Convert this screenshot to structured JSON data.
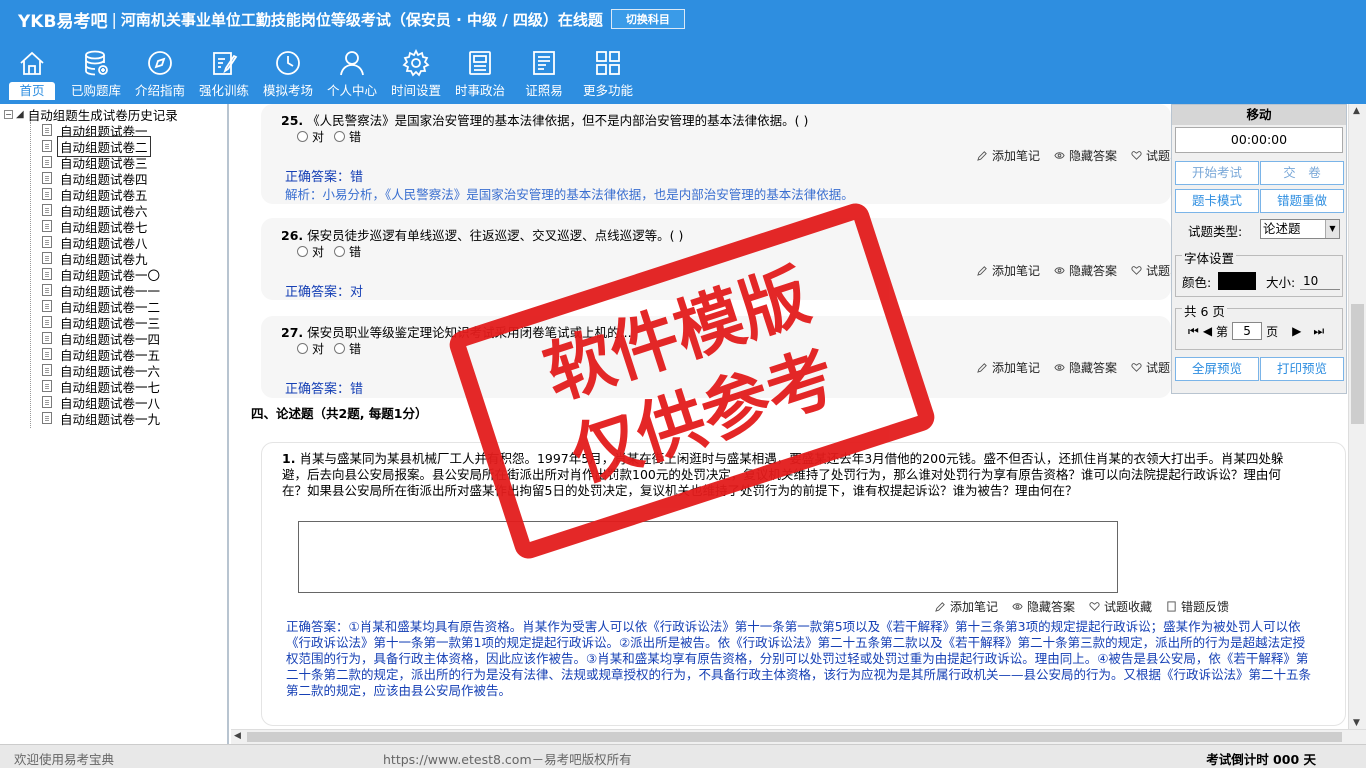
{
  "header": {
    "logo": "YKB易考吧",
    "separator": "|",
    "title": "河南机关事业单位工勤技能岗位等级考试（保安员 · 中级 / 四级）在线题",
    "switch_label": "切换科目"
  },
  "nav": [
    {
      "label": "首页",
      "icon": "home-icon"
    },
    {
      "label": "已购题库",
      "icon": "database-icon"
    },
    {
      "label": "介绍指南",
      "icon": "compass-icon"
    },
    {
      "label": "强化训练",
      "icon": "edit-icon"
    },
    {
      "label": "模拟考场",
      "icon": "clock-icon"
    },
    {
      "label": "个人中心",
      "icon": "user-icon"
    },
    {
      "label": "时间设置",
      "icon": "gear-icon"
    },
    {
      "label": "时事政治",
      "icon": "news-icon"
    },
    {
      "label": "证照易",
      "icon": "certificate-icon"
    },
    {
      "label": "更多功能",
      "icon": "grid-icon"
    }
  ],
  "tree": {
    "expander": "−",
    "root": "自动组题生成试卷历史记录",
    "items": [
      "自动组题试卷一",
      "自动组题试卷二",
      "自动组题试卷三",
      "自动组题试卷四",
      "自动组题试卷五",
      "自动组题试卷六",
      "自动组题试卷七",
      "自动组题试卷八",
      "自动组题试卷九",
      "自动组题试卷一〇",
      "自动组题试卷一一",
      "自动组题试卷一二",
      "自动组题试卷一三",
      "自动组题试卷一四",
      "自动组题试卷一五",
      "自动组题试卷一六",
      "自动组题试卷一七",
      "自动组题试卷一八",
      "自动组题试卷一九"
    ],
    "selected_index": 1
  },
  "questions": [
    {
      "num": "25.",
      "text": "《人民警察法》是国家治安管理的基本法律依据，但不是内部治安管理的基本法律依据。( )",
      "opt_true": "对",
      "opt_false": "错",
      "answer": "正确答案：错",
      "analysis": "解析：小易分析，《人民警察法》是国家治安管理的基本法律依据，也是内部治安管理的基本法律依据。"
    },
    {
      "num": "26.",
      "text": "保安员徒步巡逻有单线巡逻、往返巡逻、交叉巡逻、点线巡逻等。( )",
      "opt_true": "对",
      "opt_false": "错",
      "answer": "正确答案：对"
    },
    {
      "num": "27.",
      "text": "保安员职业等级鉴定理论知识考试采用闭卷笔试或上机的...",
      "opt_true": "对",
      "opt_false": "错",
      "answer": "正确答案：错"
    }
  ],
  "tools": {
    "note": "添加笔记",
    "hide": "隐藏答案",
    "fav": "试题收藏",
    "report": "错题反馈",
    "report_short": "错"
  },
  "section": "四、论述题（共2题, 每题1分）",
  "essay": {
    "num": "1.",
    "text": "肖某与盛某同为某县机械厂工人并有积怨。1997年5月，肖某在街上闲逛时与盛某相遇，要盛某还去年3月借他的200元钱。盛不但否认，还抓住肖某的衣领大打出手。肖某四处躲避，后去向县公安局报案。县公安局所在街派出所对肖作出罚款100元的处罚决定，复议机关维持了处罚行为，那么谁对处罚行为享有原告资格？谁可以向法院提起行政诉讼？理由何在？如果县公安局所在街派出所对盛某作出拘留5日的处罚决定，复议机关也维持了处罚行为的前提下，谁有权提起诉讼？谁为被告？理由何在？",
    "answer": "正确答案：①肖某和盛某均具有原告资格。肖某作为受害人可以依《行政诉讼法》第十一条第一款第5项以及《若干解释》第十三条第3项的规定提起行政诉讼；盛某作为被处罚人可以依《行政诉讼法》第十一条第一款第1项的规定提起行政诉讼。②派出所是被告。依《行政诉讼法》第二十五条第二款以及《若干解释》第二十条第三款的规定，派出所的行为是超越法定授权范围的行为，具备行政主体资格，因此应该作被告。③肖某和盛某均享有原告资格，分别可以处罚过轻或处罚过重为由提起行政诉讼。理由同上。④被告是县公安局，依《若干解释》第二十条第二款的规定，派出所的行为是没有法律、法规或规章授权的行为，不具备行政主体资格，该行为应视为是其所属行政机关——县公安局的行为。又根据《行政诉讼法》第二十五条第二款的规定，应该由县公安局作被告。"
  },
  "panel": {
    "title": "移动",
    "timer": "00:00:00",
    "start": "开始考试",
    "submit": "交　卷",
    "card_mode": "题卡模式",
    "wrong_redo": "错题重做",
    "type_label": "试题类型:",
    "type_value": "论述题",
    "font_group": "字体设置",
    "color_label": "颜色:",
    "size_label": "大小:",
    "size_value": "10",
    "page_group": "共 6 页",
    "page_prefix": "第",
    "page_value": "5",
    "page_suffix": "页",
    "fullscreen": "全屏预览",
    "print": "打印预览",
    "color_value": "#000000"
  },
  "status": {
    "left": "欢迎使用易考宝典",
    "center": "https://www.etest8.com－易考吧版权所有",
    "right": "考试倒计时 000 天"
  },
  "watermark": {
    "line1": "软件模版",
    "line2": "仅供参考"
  },
  "colors": {
    "header_bg": "#2e8ee0",
    "answer": "#1640b5",
    "watermark": "#e31c1c"
  }
}
